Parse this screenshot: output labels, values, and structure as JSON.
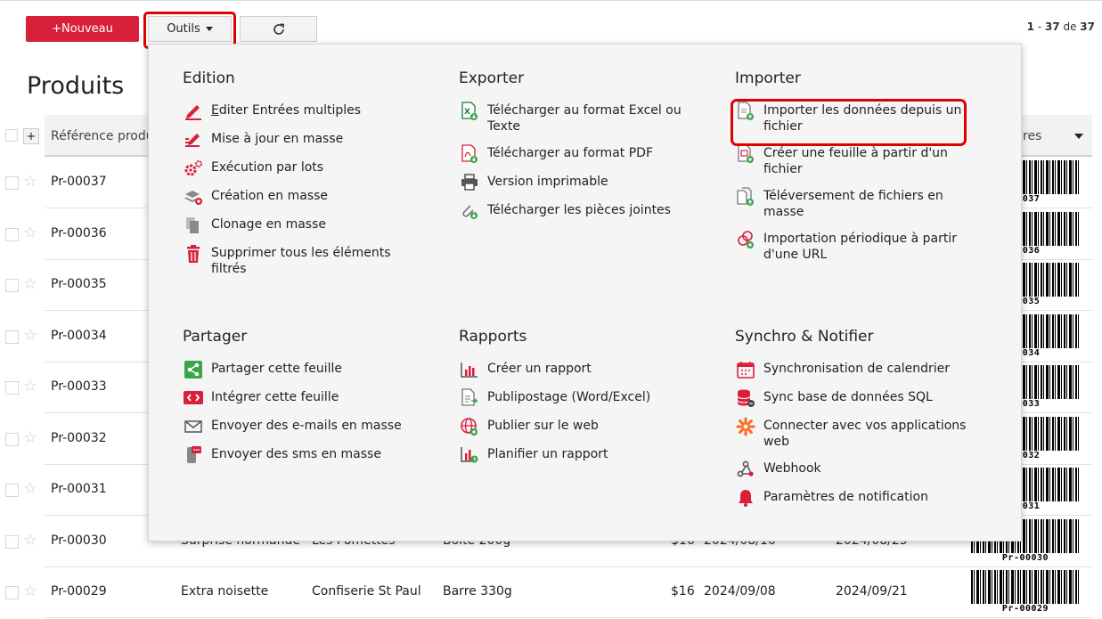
{
  "toolbar": {
    "new_label": "+Nouveau",
    "tools_label": "Outils"
  },
  "pager": {
    "start": "1",
    "sep": " - ",
    "end": "37",
    "of": " de ",
    "total": "37"
  },
  "page_title": "Produits",
  "table": {
    "header_ref": "Référence produ",
    "header_right": "res",
    "rows": [
      {
        "ref": "Pr-00037",
        "barcode": "00037"
      },
      {
        "ref": "Pr-00036",
        "barcode": "00036"
      },
      {
        "ref": "Pr-00035",
        "barcode": "00035"
      },
      {
        "ref": "Pr-00034",
        "barcode": "00034"
      },
      {
        "ref": "Pr-00033",
        "barcode": "00033"
      },
      {
        "ref": "Pr-00032",
        "barcode": "00032"
      },
      {
        "ref": "Pr-00031",
        "barcode": "00031"
      },
      {
        "ref": "Pr-00030",
        "barcode": "Pr-00030",
        "c1": "Surprise normande",
        "c2": "Les Pomettes",
        "c3": "Boîte 200g",
        "c4": "$16",
        "c5": "2024/08/16",
        "c6": "2024/08/25"
      },
      {
        "ref": "Pr-00029",
        "barcode": "Pr-00029",
        "c1": "Extra noisette",
        "c2": "Confiserie St Paul",
        "c3": "Barre 330g",
        "c4": "$16",
        "c5": "2024/09/08",
        "c6": "2024/09/21"
      }
    ]
  },
  "menu": {
    "edition": {
      "title": "Edition",
      "items": [
        {
          "label": "Editer Entrées multiples",
          "icon": "pencil-lines-icon"
        },
        {
          "label": "Mise à jour en masse",
          "icon": "bulk-update-icon"
        },
        {
          "label": "Exécution par lots",
          "icon": "gears-icon"
        },
        {
          "label": "Création en masse",
          "icon": "layers-plus-icon"
        },
        {
          "label": "Clonage en masse",
          "icon": "copy-icon"
        },
        {
          "label": "Supprimer tous les éléments filtrés",
          "icon": "trash-icon"
        }
      ]
    },
    "exporter": {
      "title": "Exporter",
      "items": [
        {
          "label": "Télécharger au format Excel ou Texte",
          "icon": "excel-download-icon"
        },
        {
          "label": "Télécharger au format PDF",
          "icon": "pdf-download-icon"
        },
        {
          "label": "Version imprimable",
          "icon": "printer-icon"
        },
        {
          "label": "Télécharger les pièces jointes",
          "icon": "paperclip-download-icon"
        }
      ]
    },
    "importer": {
      "title": "Importer",
      "items": [
        {
          "label": "Importer les données depuis un fichier",
          "icon": "file-import-icon"
        },
        {
          "label": "Créer une feuille à partir d'un fichier",
          "icon": "sheet-from-file-icon"
        },
        {
          "label": "Téléversement de fichiers en masse",
          "icon": "bulk-upload-icon"
        },
        {
          "label": "Importation périodique à partir d'une URL",
          "icon": "link-import-icon"
        }
      ]
    },
    "partager": {
      "title": "Partager",
      "items": [
        {
          "label": "Partager cette feuille",
          "icon": "share-icon"
        },
        {
          "label": "Intégrer cette feuille",
          "icon": "embed-code-icon"
        },
        {
          "label": "Envoyer des e-mails en masse",
          "icon": "envelope-icon"
        },
        {
          "label": "Envoyer des sms en masse",
          "icon": "sms-icon"
        }
      ]
    },
    "rapports": {
      "title": "Rapports",
      "items": [
        {
          "label": "Créer un rapport",
          "icon": "bar-chart-icon"
        },
        {
          "label": "Publipostage (Word/Excel)",
          "icon": "mail-merge-icon"
        },
        {
          "label": "Publier sur le web",
          "icon": "globe-icon"
        },
        {
          "label": "Planifier un rapport",
          "icon": "schedule-report-icon"
        }
      ]
    },
    "synchro": {
      "title": "Synchro & Notifier",
      "items": [
        {
          "label": "Synchronisation de calendrier",
          "icon": "calendar-icon"
        },
        {
          "label": "Sync base de données SQL",
          "icon": "database-icon"
        },
        {
          "label": "Connecter avec vos applications web",
          "icon": "zapier-icon"
        },
        {
          "label": "Webhook",
          "icon": "webhook-icon"
        },
        {
          "label": "Paramètres de notification",
          "icon": "bell-icon"
        }
      ]
    }
  },
  "colors": {
    "accent": "#d9203b",
    "highlight": "#e00000",
    "green": "#3aa54a"
  }
}
